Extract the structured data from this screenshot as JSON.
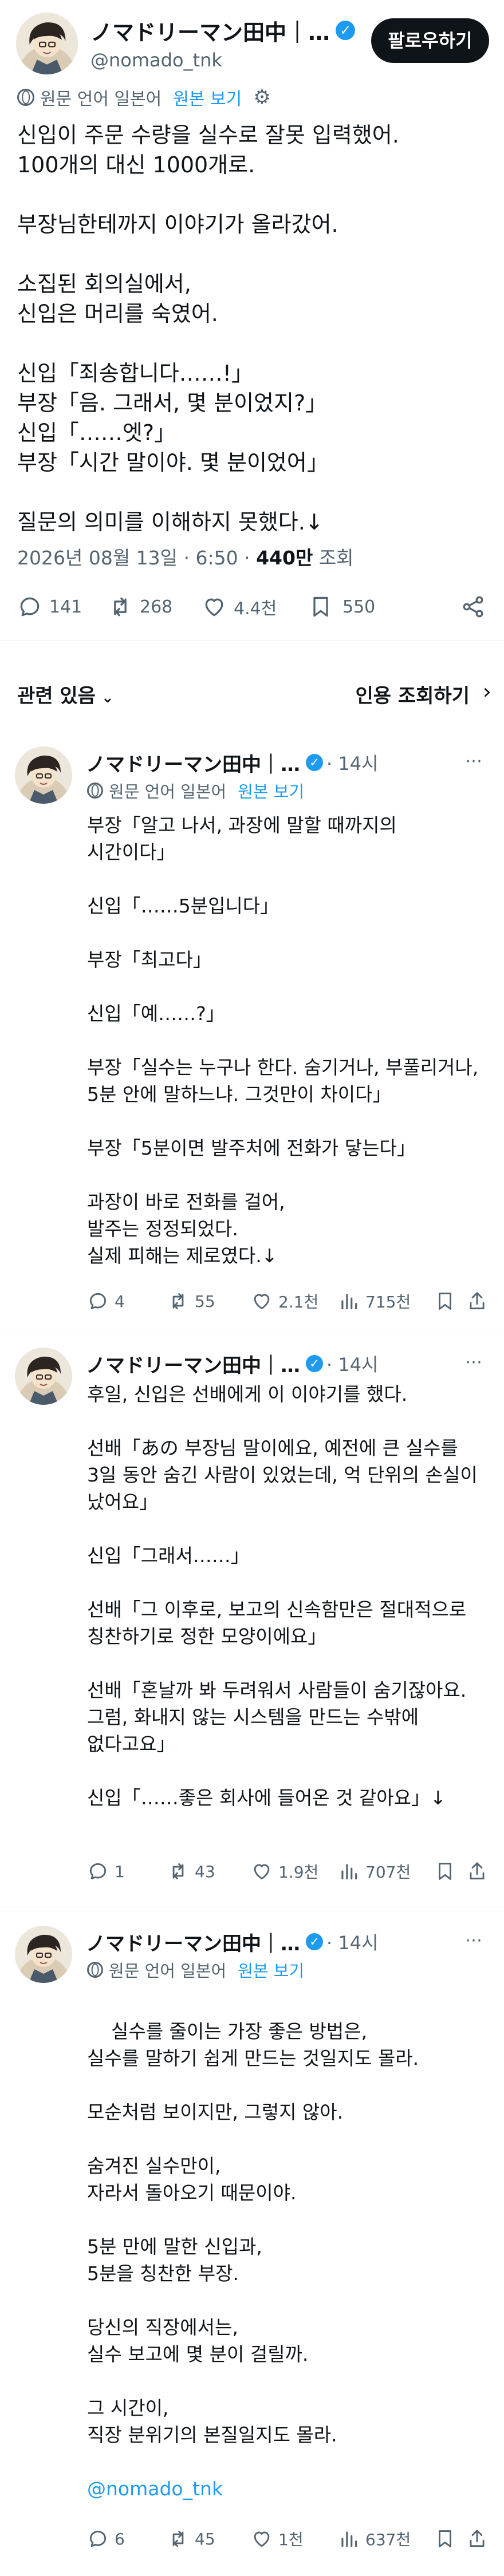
{
  "main": {
    "author_name": "ノマドリーマン田中｜…",
    "handle": "@nomado_tnk",
    "follow_label": "팔로우하기",
    "translate_label": "원문 언어 일본어",
    "show_original_label": "원본 보기",
    "body": "신입이 주문 수량을 실수로 잘못 입력했어.\n100개의 대신 1000개로.\n\n부장님한테까지 이야기가 올라갔어.\n\n소집된 회의실에서,\n신입은 머리를 숙였어.\n\n신입「죄송합니다……!」\n부장「음. 그래서, 몇 분이었지?」\n신입「……엣?」\n부장「시간 말이야. 몇 분이었어」\n\n질문의 의미를 이해하지 못했다.↓",
    "date": "2026년 08월 13일 · 6:50 · ",
    "views": "440만",
    "views_suffix": " 조회",
    "replies": "141",
    "reposts": "268",
    "likes": "4.4천",
    "bookmarks": "550"
  },
  "related": {
    "left_label": "관련 있음",
    "right_label": "인용 조회하기"
  },
  "replies": [
    {
      "author_name": "ノマドリーマン田中｜…",
      "time": "· 14시",
      "translate_label": "원문 언어 일본어",
      "show_original_label": "원본 보기",
      "body": "부장「알고 나서, 과장에 말할 때까지의\n시간이다」\n\n신입「……5분입니다」\n\n부장「최고다」\n\n신입「예……?」\n\n부장「실수는 누구나 한다. 숨기거나, 부풀리거나,\n5분 안에 말하느냐. 그것만이 차이다」\n\n부장「5분이면 발주처에 전화가 닿는다」\n\n과장이 바로 전화를 걸어,\n발주는 정정되었다.\n실제 피해는 제로였다.↓",
      "replies": "4",
      "reposts": "55",
      "likes": "2.1천",
      "views": "715천"
    },
    {
      "author_name": "ノマドリーマン田中｜…",
      "time": "· 14시",
      "body": "후일, 신입은 선배에게 이 이야기를 했다.\n\n선배「あの 부장님 말이에요, 예전에 큰 실수를\n3일 동안 숨긴 사람이 있었는데, 억 단위의 손실이\n났어요」\n\n신입「그래서……」\n\n선배「그 이후로, 보고의 신속함만은 절대적으로\n칭찬하기로 정한 모양이에요」\n\n선배「혼날까 봐 두려워서 사람들이 숨기잖아요.\n그럼, 화내지 않는 시스템을 만드는 수밖에\n없다고요」\n\n신입「……좋은 회사에 들어온 것 같아요」↓",
      "replies": "1",
      "reposts": "43",
      "likes": "1.9천",
      "views": "707천"
    },
    {
      "author_name": "ノマドリーマン田中｜…",
      "time": "· 14시",
      "translate_label": "원문 언어 일본어",
      "show_original_label": "원본 보기",
      "body": "실수를 줄이는 가장 좋은 방법은,\n실수를 말하기 쉽게 만드는 것일지도 몰라.\n\n모순처럼 보이지만, 그렇지 않아.\n\n숨겨진 실수만이,\n자라서 돌아오기 때문이야.\n\n5분 만에 말한 신입과,\n5분을 칭찬한 부장.\n\n당신의 직장에서는,\n실수 보고에 몇 분이 걸릴까.\n\n그 시간이,\n직장 분위기의 본질일지도 몰라.",
      "handle_link": "@nomado_tnk",
      "replies": "6",
      "reposts": "45",
      "likes": "1천",
      "views": "637천"
    }
  ]
}
